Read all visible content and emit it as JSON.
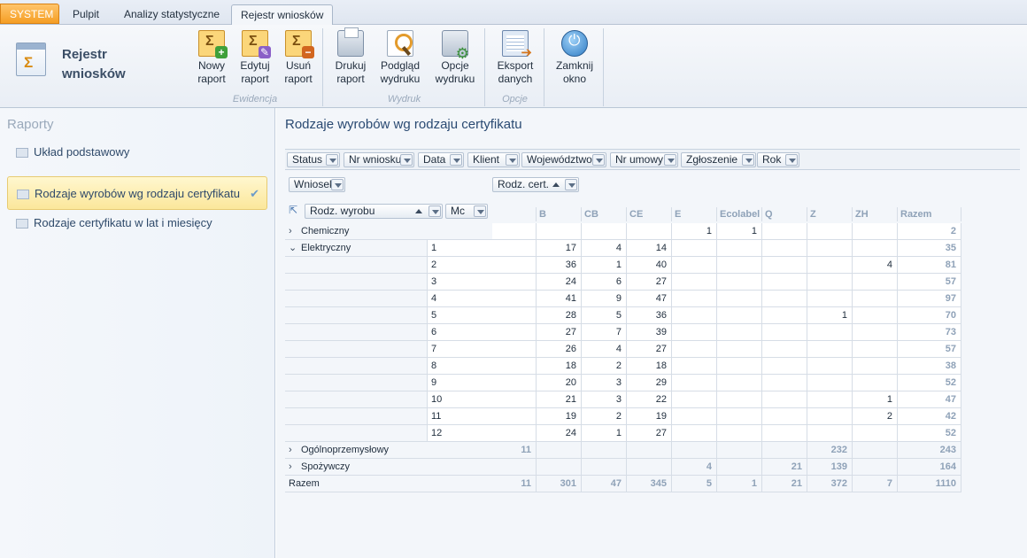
{
  "tabs": {
    "system": "SYSTEM",
    "pulpit": "Pulpit",
    "analizy": "Analizy statystyczne",
    "rejestr": "Rejestr wniosków"
  },
  "module": {
    "title_line1": "Rejestr",
    "title_line2": "wniosków"
  },
  "ribbon": {
    "groups": {
      "ewidencja": "Ewidencja",
      "wydruk": "Wydruk",
      "opcje": "Opcje"
    },
    "buttons": {
      "nowy": [
        "Nowy",
        "raport"
      ],
      "edytuj": [
        "Edytuj",
        "raport"
      ],
      "usun": [
        "Usuń",
        "raport"
      ],
      "drukuj": [
        "Drukuj",
        "raport"
      ],
      "podglad": [
        "Podgląd",
        "wydruku"
      ],
      "opcje_wydruku": [
        "Opcje",
        "wydruku"
      ],
      "eksport": [
        "Eksport",
        "danych"
      ],
      "zamknij": [
        "Zamknij",
        "okno"
      ]
    }
  },
  "left_panel": {
    "header": "Raporty",
    "items": [
      "Układ podstawowy",
      "Rodzaje wyrobów wg rodzaju certyfikatu",
      "Rodzaje certyfikatu w lat i miesięcy"
    ]
  },
  "main": {
    "title": "Rodzaje wyrobów wg rodzaju certyfikatu",
    "filter_fields": [
      "Status",
      "Nr wniosku",
      "Data",
      "Klient",
      "Województwo",
      "Nr umowy",
      "Zgłoszenie",
      "Rok"
    ],
    "data_field": "Wniosek",
    "column_field": "Rodz. cert.",
    "row_fields": [
      "Rodz. wyrobu",
      "Mc"
    ]
  },
  "pivot": {
    "columns": [
      "",
      "B",
      "CB",
      "CE",
      "E",
      "Ecolabel",
      "Q",
      "Z",
      "ZH",
      "Razem"
    ],
    "rows": [
      {
        "label": "Chemiczny",
        "expand": "›",
        "sub": "",
        "values": [
          "",
          "",
          "",
          "",
          "1",
          "1",
          "",
          "",
          "",
          "2"
        ],
        "agg": false
      },
      {
        "label": "Elektryczny",
        "expand": "⌄",
        "sub": "1",
        "values": [
          "",
          "17",
          "4",
          "14",
          "",
          "",
          "",
          "",
          "",
          "35"
        ],
        "agg": false
      },
      {
        "label": "",
        "expand": "",
        "sub": "2",
        "values": [
          "",
          "36",
          "1",
          "40",
          "",
          "",
          "",
          "",
          "4",
          "81"
        ],
        "agg": false
      },
      {
        "label": "",
        "expand": "",
        "sub": "3",
        "values": [
          "",
          "24",
          "6",
          "27",
          "",
          "",
          "",
          "",
          "",
          "57"
        ],
        "agg": false
      },
      {
        "label": "",
        "expand": "",
        "sub": "4",
        "values": [
          "",
          "41",
          "9",
          "47",
          "",
          "",
          "",
          "",
          "",
          "97"
        ],
        "agg": false
      },
      {
        "label": "",
        "expand": "",
        "sub": "5",
        "values": [
          "",
          "28",
          "5",
          "36",
          "",
          "",
          "",
          "1",
          "",
          "70"
        ],
        "agg": false
      },
      {
        "label": "",
        "expand": "",
        "sub": "6",
        "values": [
          "",
          "27",
          "7",
          "39",
          "",
          "",
          "",
          "",
          "",
          "73"
        ],
        "agg": false
      },
      {
        "label": "",
        "expand": "",
        "sub": "7",
        "values": [
          "",
          "26",
          "4",
          "27",
          "",
          "",
          "",
          "",
          "",
          "57"
        ],
        "agg": false
      },
      {
        "label": "",
        "expand": "",
        "sub": "8",
        "values": [
          "",
          "18",
          "2",
          "18",
          "",
          "",
          "",
          "",
          "",
          "38"
        ],
        "agg": false
      },
      {
        "label": "",
        "expand": "",
        "sub": "9",
        "values": [
          "",
          "20",
          "3",
          "29",
          "",
          "",
          "",
          "",
          "",
          "52"
        ],
        "agg": false
      },
      {
        "label": "",
        "expand": "",
        "sub": "10",
        "values": [
          "",
          "21",
          "3",
          "22",
          "",
          "",
          "",
          "",
          "1",
          "47"
        ],
        "agg": false
      },
      {
        "label": "",
        "expand": "",
        "sub": "11",
        "values": [
          "",
          "19",
          "2",
          "19",
          "",
          "",
          "",
          "",
          "2",
          "42"
        ],
        "agg": false
      },
      {
        "label": "",
        "expand": "",
        "sub": "12",
        "values": [
          "",
          "24",
          "1",
          "27",
          "",
          "",
          "",
          "",
          "",
          "52"
        ],
        "agg": false
      },
      {
        "label": "Ogólnoprzemysłowy",
        "expand": "›",
        "sub": "",
        "values": [
          "11",
          "",
          "",
          "",
          "",
          "",
          "",
          "232",
          "",
          "243"
        ],
        "agg": true
      },
      {
        "label": "Spożywczy",
        "expand": "›",
        "sub": "",
        "values": [
          "",
          "",
          "",
          "",
          "4",
          "",
          "21",
          "139",
          "",
          "164"
        ],
        "agg": true
      },
      {
        "label": "Razem",
        "expand": "",
        "sub": "",
        "values": [
          "11",
          "301",
          "47",
          "345",
          "5",
          "1",
          "21",
          "372",
          "7",
          "1110"
        ],
        "agg": true
      }
    ]
  },
  "colors": {
    "accent": "#2a4a72",
    "system_tab": "#f59e24",
    "selection": "#fbe79b",
    "total_text": "#8fa2b8"
  }
}
